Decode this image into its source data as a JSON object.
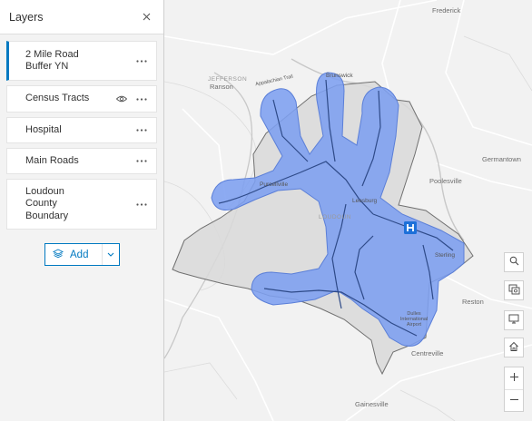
{
  "panel": {
    "title": "Layers",
    "close_icon": "close-icon",
    "layers": [
      {
        "name": "2 Mile Road Buffer YN",
        "line1": "2 Mile Road",
        "line2": "Buffer YN",
        "active": true,
        "visibility_icon": false
      },
      {
        "name": "Census Tracts",
        "line1": "Census Tracts",
        "active": false,
        "visibility_icon": true
      },
      {
        "name": "Hospital",
        "line1": "Hospital",
        "active": false,
        "visibility_icon": false
      },
      {
        "name": "Main Roads",
        "line1": "Main Roads",
        "active": false,
        "visibility_icon": false
      },
      {
        "name": "Loudoun County Boundary",
        "line1": "Loudoun",
        "line2": "County",
        "line3": "Boundary",
        "active": false,
        "visibility_icon": false
      }
    ],
    "add_button": {
      "label": "Add",
      "icon": "layers-icon",
      "dropdown_icon": "chevron-down-icon"
    }
  },
  "map": {
    "labels": {
      "frederick": "Frederick",
      "jefferson": "JEFFERSON",
      "ranson": "Ranson",
      "brunswick": "Brunswick",
      "appalachian": "Appalachian Trail",
      "purcellville": "Purcellville",
      "leesburg": "Leesburg",
      "loudoun": "LOUDOUN",
      "poolesville": "Poolesville",
      "germantown": "Germantown",
      "sterling": "Sterling",
      "reston": "Reston",
      "dulles": "Dulles International Airport",
      "centreville": "Centreville",
      "gainesville": "Gainesville"
    },
    "colors": {
      "buffer_fill": "#7d9ff0",
      "buffer_stroke": "#5b7fd8",
      "boundary_fill": "#d9d9d9",
      "roads": "#2e4a88",
      "hospital": "#1d70d9"
    },
    "hospital_icon": "hospital-icon",
    "controls": {
      "search": "search-icon",
      "basemap": "basemap-gallery-icon",
      "fullscreen": "monitor-icon",
      "home": "home-icon",
      "zoom_in": "plus-icon",
      "zoom_out": "minus-icon"
    }
  }
}
